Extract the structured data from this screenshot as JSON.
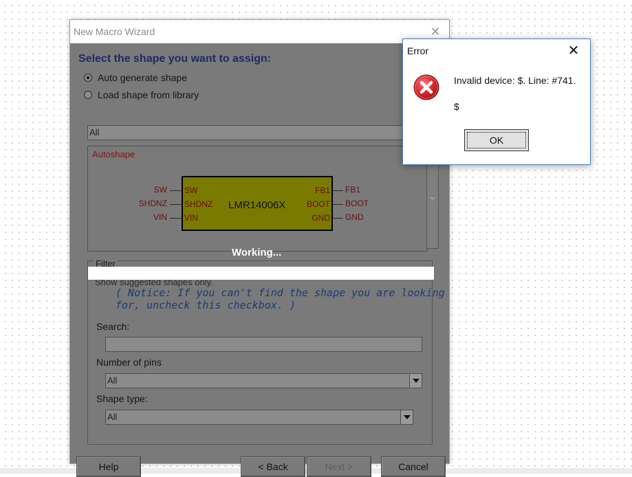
{
  "wizard": {
    "title": "New Macro Wizard",
    "heading": "Select the shape you want to assign:",
    "radio_auto": "Auto generate shape",
    "radio_library": "Load shape from library",
    "library_combo_value": "All",
    "preview_label": "Autoshape",
    "chip": {
      "name": "LMR14006X",
      "left_pins": [
        {
          "outer": "SW",
          "inner": "SW"
        },
        {
          "outer": "SHDNZ",
          "inner": "SHDNZ"
        },
        {
          "outer": "VIN",
          "inner": "VIN"
        }
      ],
      "right_pins": [
        {
          "inner": "FB1",
          "outer": "FB1"
        },
        {
          "inner": "BOOT",
          "outer": "BOOT"
        },
        {
          "inner": "GND",
          "outer": "GND"
        }
      ]
    },
    "working_text": "Working...",
    "filter_title": "Filter",
    "suggested_text": "Show suggested shapes only.",
    "notice_line1": "( Notice: If you can't find the shape you are looking",
    "notice_line2": "for, uncheck this checkbox. )",
    "search_label": "Search:",
    "pins_label": "Number of pins",
    "pins_value": "All",
    "shape_type_label": "Shape type:",
    "shape_type_value": "All",
    "buttons": {
      "help": "Help",
      "back": "< Back",
      "next": "Next >",
      "cancel": "Cancel"
    }
  },
  "error_dialog": {
    "title": "Error",
    "message": "Invalid device: $. Line: #741.",
    "detail": "$",
    "ok": "OK"
  },
  "colors": {
    "dim_overlay": "#7a7a7a",
    "chip_fill": "#7a7a00",
    "error_icon": "#d9262a",
    "dialog_border": "#3e7fc0"
  }
}
